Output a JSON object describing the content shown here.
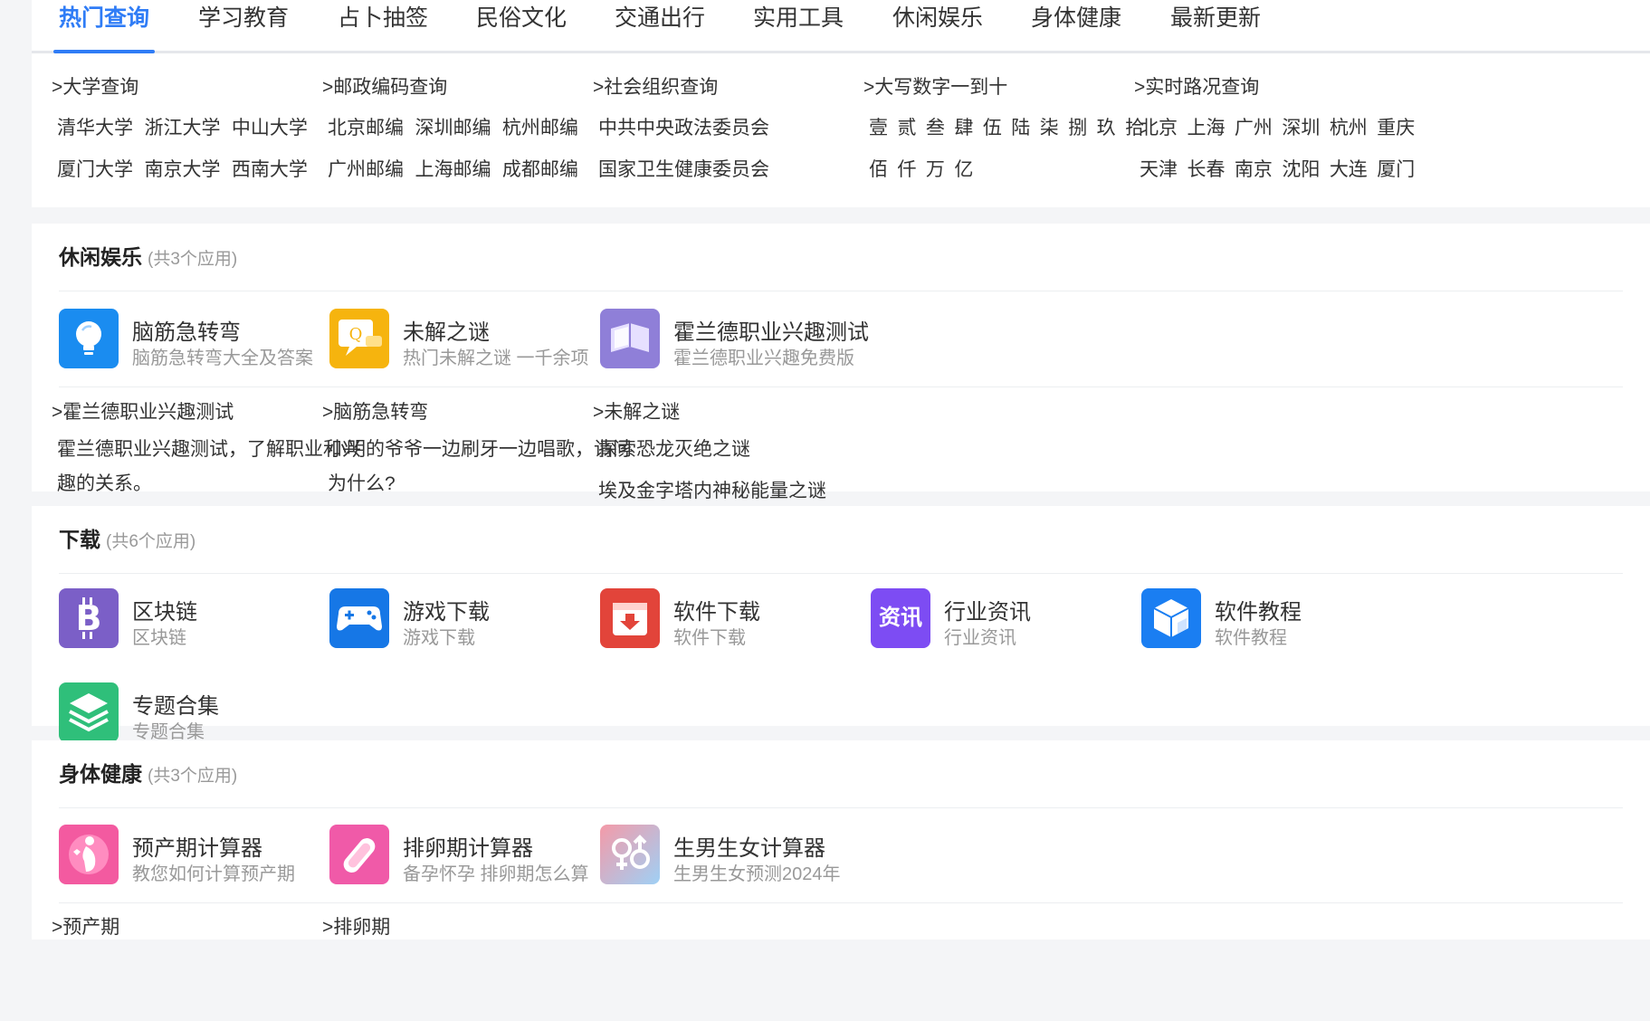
{
  "nav": {
    "tabs": [
      {
        "label": "热门查询"
      },
      {
        "label": "学习教育"
      },
      {
        "label": "占卜抽签"
      },
      {
        "label": "民俗文化"
      },
      {
        "label": "交通出行"
      },
      {
        "label": "实用工具"
      },
      {
        "label": "休闲娱乐"
      },
      {
        "label": "身体健康"
      },
      {
        "label": "最新更新"
      }
    ],
    "active_color": "#2f7cf6"
  },
  "quick": {
    "cols": [
      {
        "title": ">大学查询",
        "row1": [
          "清华大学",
          "浙江大学",
          "中山大学"
        ],
        "row2": [
          "厦门大学",
          "南京大学",
          "西南大学"
        ]
      },
      {
        "title": ">邮政编码查询",
        "row1": [
          "北京邮编",
          "深圳邮编",
          "杭州邮编"
        ],
        "row2": [
          "广州邮编",
          "上海邮编",
          "成都邮编"
        ]
      },
      {
        "title": ">社会组织查询",
        "row1": [
          "中共中央政法委员会"
        ],
        "row2": [
          "国家卫生健康委员会"
        ]
      },
      {
        "title": ">大写数字一到十",
        "row1": [
          "壹",
          "贰",
          "叁",
          "肆",
          "伍",
          "陆",
          "柒",
          "捌",
          "玖",
          "拾"
        ],
        "row2": [
          "佰",
          "仟",
          "万",
          "亿"
        ]
      },
      {
        "title": ">实时路况查询",
        "row1": [
          "北京",
          "上海",
          "广州",
          "深圳",
          "杭州",
          "重庆"
        ],
        "row2": [
          "天津",
          "长春",
          "南京",
          "沈阳",
          "大连",
          "厦门"
        ]
      }
    ]
  },
  "leisure": {
    "title": "休闲娱乐",
    "count": "(共3个应用)",
    "apps": [
      {
        "name": "脑筋急转弯",
        "desc": "脑筋急转弯大全及答案",
        "icon": "lightbulb-icon",
        "color": "#1a8cf0"
      },
      {
        "name": "未解之谜",
        "desc": "热门未解之谜 一千余项",
        "icon": "question-icon",
        "color": "#f6b40e"
      },
      {
        "name": "霍兰德职业兴趣测试",
        "desc": "霍兰德职业兴趣免费版",
        "icon": "book-icon",
        "color": "#8f7fd8"
      }
    ],
    "details": [
      {
        "title": ">霍兰德职业兴趣测试",
        "text": "霍兰德职业兴趣测试，了解职业和兴趣的关系。"
      },
      {
        "title": ">脑筋急转弯",
        "text": "小明的爷爷一边刷牙一边唱歌，请问为什么?"
      },
      {
        "title": ">未解之谜",
        "lines": [
          "探索恐龙灭绝之谜",
          "埃及金字塔内神秘能量之谜"
        ]
      }
    ]
  },
  "download": {
    "title": "下载",
    "count": "(共6个应用)",
    "apps": [
      {
        "name": "区块链",
        "desc": "区块链",
        "icon": "bitcoin-icon",
        "color": "#7b5fc7"
      },
      {
        "name": "游戏下载",
        "desc": "游戏下载",
        "icon": "gamepad-icon",
        "color": "#1677e6"
      },
      {
        "name": "软件下载",
        "desc": "软件下载",
        "icon": "download-box-icon",
        "color": "#e2443a"
      },
      {
        "name": "行业资讯",
        "desc": "行业资讯",
        "icon": "news-icon",
        "color": "#7d4cf3",
        "glyph": "资讯"
      },
      {
        "name": "软件教程",
        "desc": "软件教程",
        "icon": "cube-icon",
        "color": "#1a7ef2"
      },
      {
        "name": "专题合集",
        "desc": "专题合集",
        "icon": "layers-icon",
        "color": "#2fbf7a"
      }
    ]
  },
  "health": {
    "title": "身体健康",
    "count": "(共3个应用)",
    "apps": [
      {
        "name": "预产期计算器",
        "desc": "教您如何计算预产期",
        "icon": "pregnancy-icon",
        "color": "#f35aa0"
      },
      {
        "name": "排卵期计算器",
        "desc": "备孕怀孕 排卵期怎么算",
        "icon": "pad-icon",
        "color": "#f05aa8"
      },
      {
        "name": "生男生女计算器",
        "desc": "生男生女预测2024年",
        "icon": "gender-icon",
        "color": "#f49aa8"
      }
    ],
    "details": [
      {
        "title": ">预产期"
      },
      {
        "title": ">排卵期"
      }
    ]
  }
}
